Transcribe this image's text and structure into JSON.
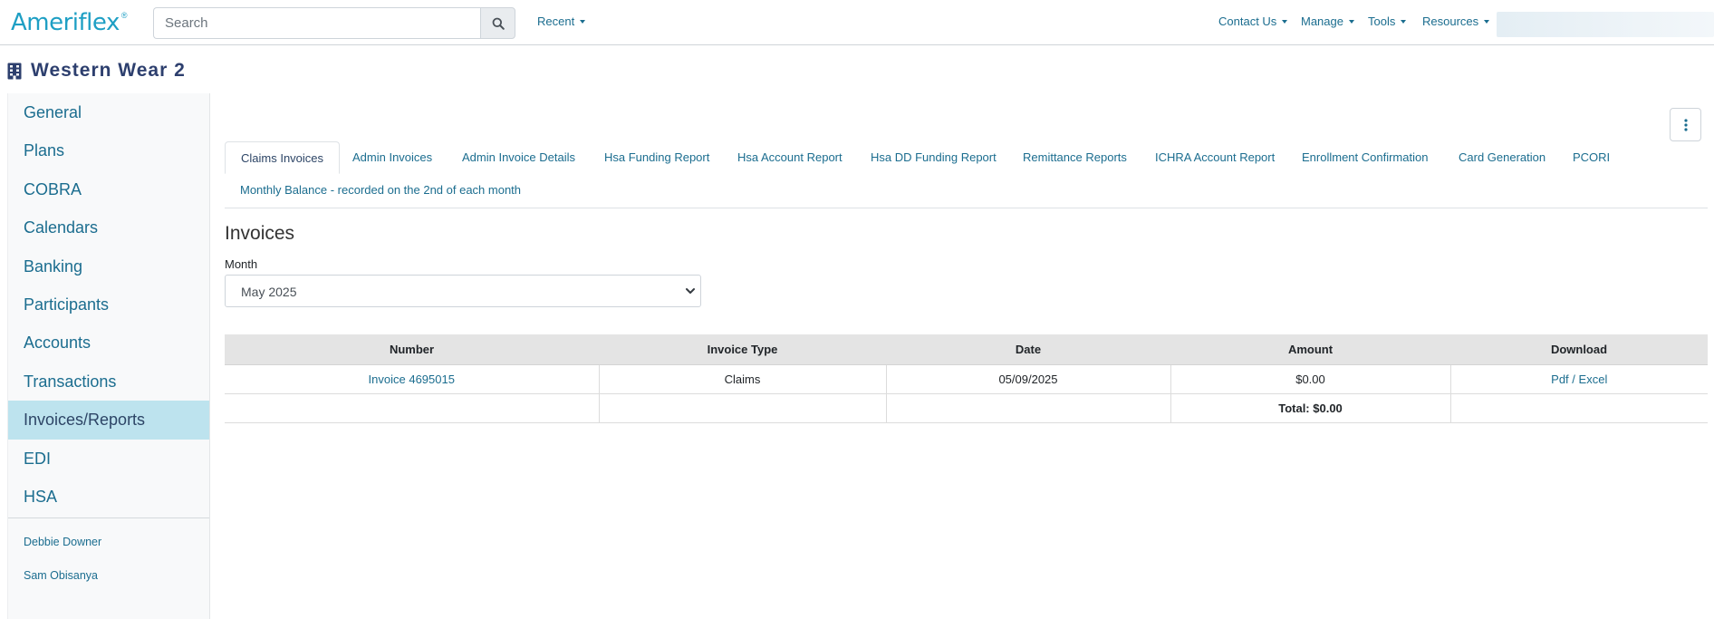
{
  "brand": {
    "logo_text": "Ameriflex",
    "logo_mark": "®"
  },
  "search": {
    "placeholder": "Search"
  },
  "nav": {
    "recent": "Recent",
    "right": [
      "Contact Us",
      "Manage",
      "Tools",
      "Resources"
    ]
  },
  "page": {
    "title": "Western Wear 2"
  },
  "sidebar": {
    "items": [
      "General",
      "Plans",
      "COBRA",
      "Calendars",
      "Banking",
      "Participants",
      "Accounts",
      "Transactions",
      "Invoices/Reports",
      "EDI",
      "HSA"
    ],
    "active_index": 8,
    "users": [
      "Debbie Downer",
      "Sam Obisanya"
    ]
  },
  "tabs": {
    "row1": [
      "Claims Invoices",
      "Admin Invoices",
      "Admin Invoice Details",
      "Hsa Funding Report",
      "Hsa Account Report",
      "Hsa DD Funding Report",
      "Remittance Reports",
      "ICHRA Account Report",
      "Enrollment Confirmation",
      "Card Generation",
      "PCORI"
    ],
    "row2": [
      "Monthly Balance - recorded on the 2nd of each month"
    ],
    "active": "Claims Invoices"
  },
  "invoices": {
    "title": "Invoices",
    "month_label": "Month",
    "month_value": "May 2025",
    "columns": [
      "Number",
      "Invoice Type",
      "Date",
      "Amount",
      "Download"
    ],
    "rows": [
      {
        "number": "Invoice 4695015",
        "type": "Claims",
        "date": "05/09/2025",
        "amount": "$0.00",
        "pdf": "Pdf",
        "sep": "/",
        "excel": "Excel"
      }
    ],
    "total": "Total: $0.00"
  },
  "colors": {
    "link": "#1b6d8f",
    "brand": "#1e9fc4",
    "active_bg": "#bde3ee",
    "title": "#2d3f6e"
  }
}
